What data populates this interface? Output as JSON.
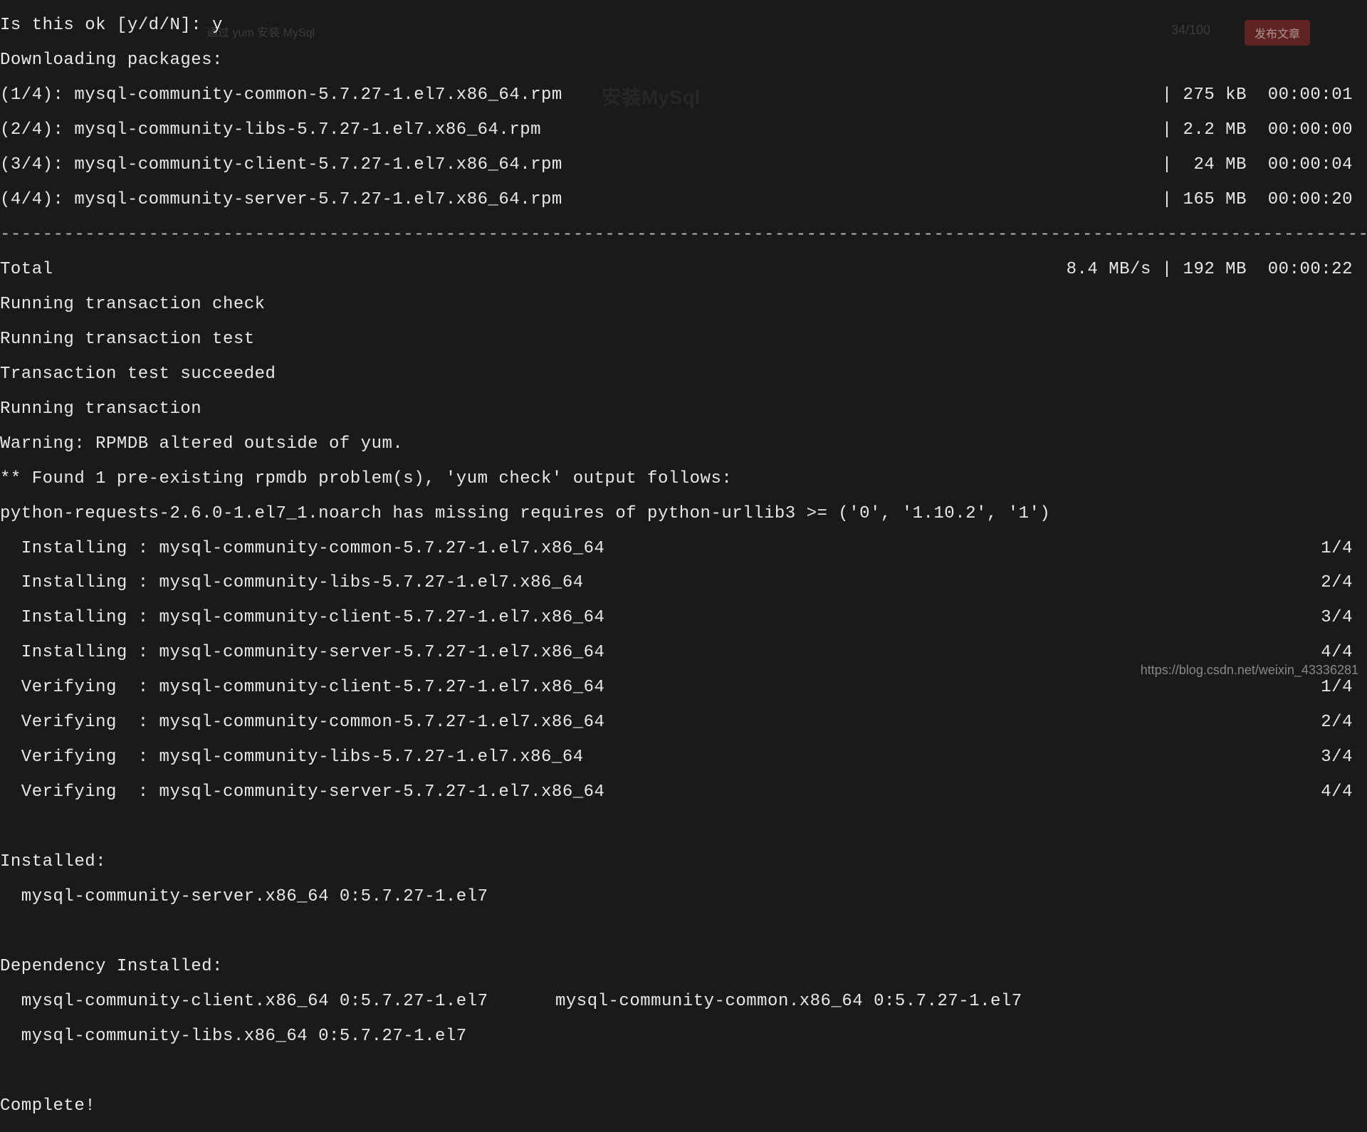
{
  "prompt_line": "Is this ok [y/d/N]: y",
  "downloading_header": "Downloading packages:",
  "downloads": [
    {
      "pkg": "(1/4): mysql-community-common-5.7.27-1.el7.x86_64.rpm",
      "size": "| 275 kB  00:00:01",
      "sep": ""
    },
    {
      "pkg": "(2/4): mysql-community-libs-5.7.27-1.el7.x86_64.rpm",
      "size": "| 2.2 MB  00:00:00",
      "sep": ""
    },
    {
      "pkg": "(3/4): mysql-community-client-5.7.27-1.el7.x86_64.rpm",
      "size": "|  24 MB  00:00:04",
      "sep": ""
    },
    {
      "pkg": "(4/4): mysql-community-server-5.7.27-1.el7.x86_64.rpm",
      "size": "| 165 MB  00:00:20",
      "sep": ""
    }
  ],
  "dashline": "--------------------------------------------------------------------------------------------------------------------------------------------------------------",
  "total_line_left": "Total",
  "total_line_right": "8.4 MB/s | 192 MB  00:00:22",
  "transaction_lines": [
    "Running transaction check",
    "Running transaction test",
    "Transaction test succeeded",
    "Running transaction",
    "Warning: RPMDB altered outside of yum.",
    "** Found 1 pre-existing rpmdb problem(s), 'yum check' output follows:",
    "python-requests-2.6.0-1.el7_1.noarch has missing requires of python-urllib3 >= ('0', '1.10.2', '1')"
  ],
  "install_steps": [
    {
      "left": "  Installing : mysql-community-common-5.7.27-1.el7.x86_64",
      "right": "1/4"
    },
    {
      "left": "  Installing : mysql-community-libs-5.7.27-1.el7.x86_64",
      "right": "2/4"
    },
    {
      "left": "  Installing : mysql-community-client-5.7.27-1.el7.x86_64",
      "right": "3/4"
    },
    {
      "left": "  Installing : mysql-community-server-5.7.27-1.el7.x86_64",
      "right": "4/4"
    },
    {
      "left": "  Verifying  : mysql-community-client-5.7.27-1.el7.x86_64",
      "right": "1/4"
    },
    {
      "left": "  Verifying  : mysql-community-common-5.7.27-1.el7.x86_64",
      "right": "2/4"
    },
    {
      "left": "  Verifying  : mysql-community-libs-5.7.27-1.el7.x86_64",
      "right": "3/4"
    },
    {
      "left": "  Verifying  : mysql-community-server-5.7.27-1.el7.x86_64",
      "right": "4/4"
    }
  ],
  "installed_header": "Installed:",
  "installed_pkg": "  mysql-community-server.x86_64 0:5.7.27-1.el7",
  "dep_header": "Dependency Installed:",
  "dep_row_left": "  mysql-community-client.x86_64 0:5.7.27-1.el7",
  "dep_row_right": "mysql-community-common.x86_64 0:5.7.27-1.el7",
  "dep_row2": "  mysql-community-libs.x86_64 0:5.7.27-1.el7",
  "complete": "Complete!",
  "watermark": "https://blog.csdn.net/weixin_43336281",
  "bg_editor": {
    "counter": "34/100",
    "publish": "发布文章",
    "title": "安装MySql",
    "breadcrumb": "通过 yum 安装 MySql"
  }
}
